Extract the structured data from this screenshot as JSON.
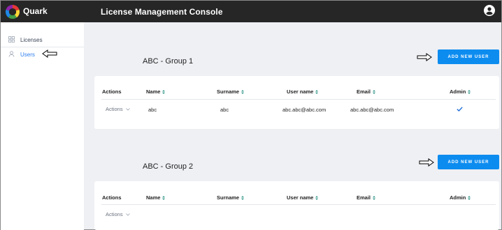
{
  "header": {
    "brand": "Quark",
    "title": "License Management Console",
    "brand_colors": [
      "#e53935",
      "#fdd835",
      "#43a047",
      "#1e88e5",
      "#8e24aa"
    ]
  },
  "sidebar": {
    "items": [
      {
        "label": "Licenses",
        "icon": "grid-icon",
        "active": false
      },
      {
        "label": "Users",
        "icon": "user-icon",
        "active": true
      }
    ]
  },
  "table_columns": [
    "Actions",
    "Name",
    "Surname",
    "User name",
    "Email",
    "Admin"
  ],
  "groups": [
    {
      "title": "ABC - Group 1",
      "add_button": "ADD NEW USER",
      "rows": [
        {
          "actions": "Actions",
          "name": "abc",
          "surname": "abc",
          "username": "abc.abc@abc.com",
          "email": "abc.abc@abc.com",
          "admin": true
        }
      ]
    },
    {
      "title": "ABC - Group 2",
      "add_button": "ADD NEW USER",
      "rows": [
        {
          "actions": "Actions"
        }
      ]
    }
  ],
  "colors": {
    "accent": "#0d8cf0",
    "topbar": "#262626",
    "active_link": "#2f80ed",
    "sort_icon": "#3a9a8c"
  }
}
